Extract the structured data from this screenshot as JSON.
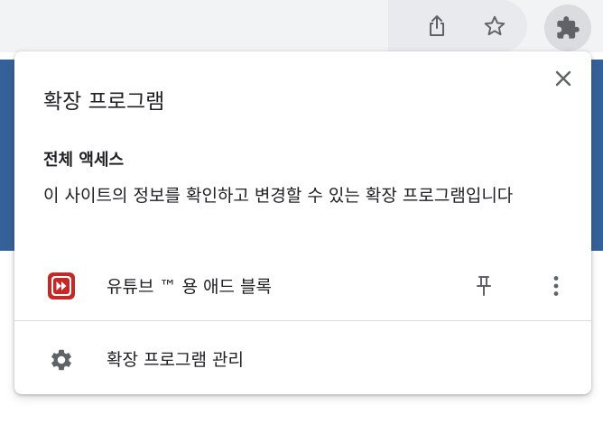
{
  "toolbar": {
    "share_icon": "share-icon",
    "bookmark_icon": "star-icon",
    "extensions_icon": "puzzle-icon"
  },
  "popup": {
    "title": "확장 프로그램",
    "close_icon": "close-icon",
    "section": {
      "heading": "전체 액세스",
      "description": "이 사이트의 정보를 확인하고 변경할 수 있는 확장 프로그램입니다"
    },
    "extensions": [
      {
        "name": "유튜브 ™ 용 애드 블록",
        "icon": "fast-forward-icon",
        "pin_icon": "pin-icon",
        "menu_icon": "more-vert-icon"
      }
    ],
    "manage": {
      "label": "확장 프로그램 관리",
      "icon": "gear-icon"
    }
  },
  "colors": {
    "toolbar_bg": "#f1f3f4",
    "page_header": "#35619a",
    "text": "#202124",
    "icon": "#5f6368",
    "extension_accent": "#c62828"
  }
}
